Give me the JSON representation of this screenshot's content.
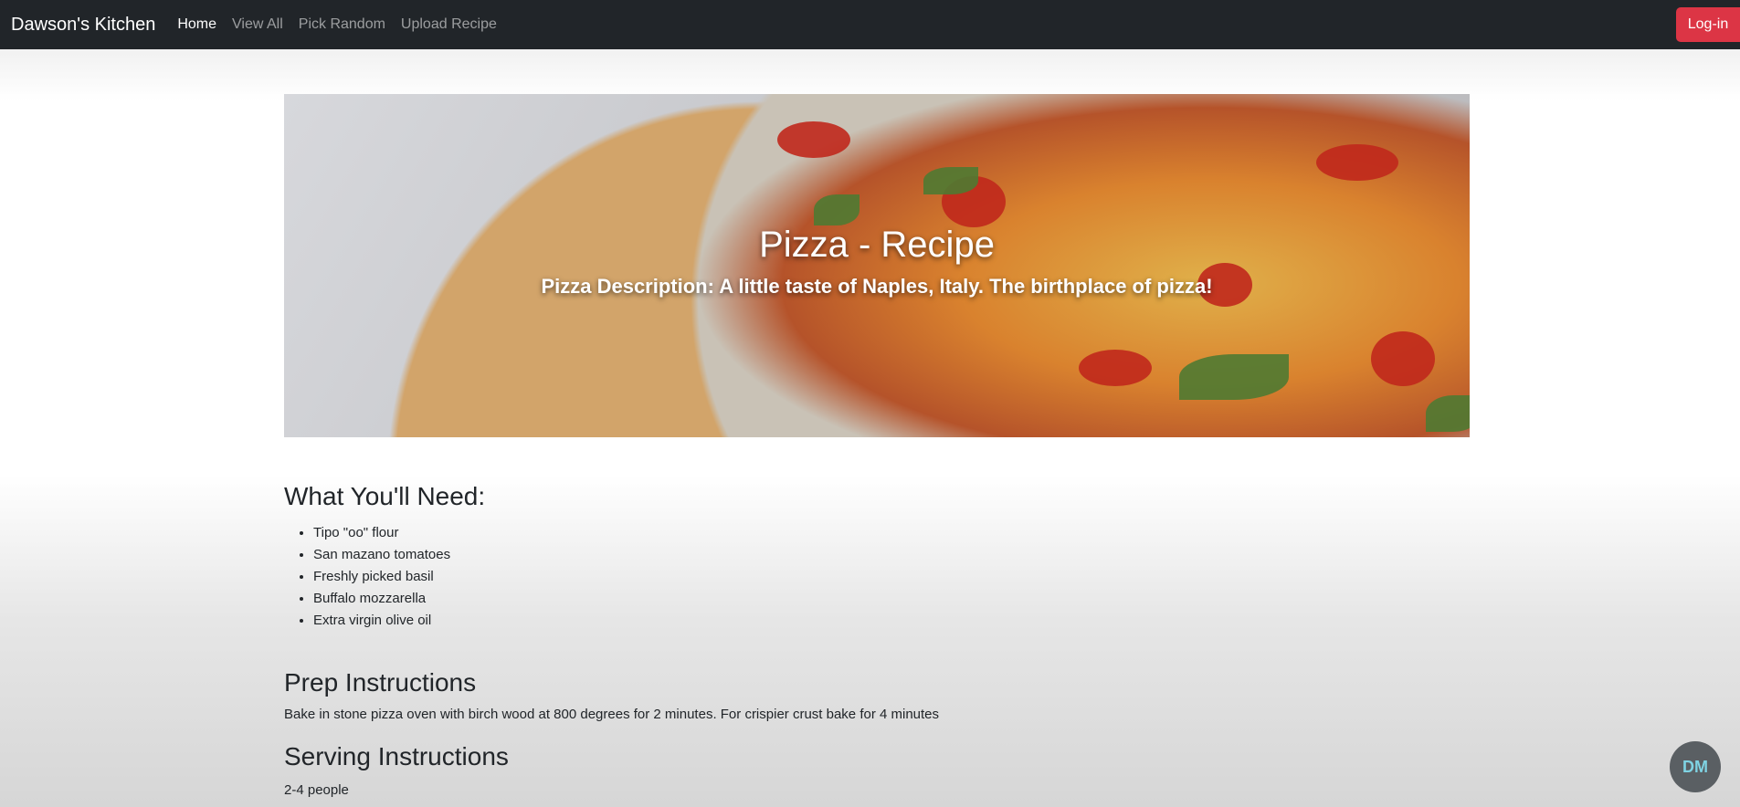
{
  "navbar": {
    "brand": "Dawson's Kitchen",
    "links": [
      {
        "label": "Home",
        "active": true
      },
      {
        "label": "View All",
        "active": false
      },
      {
        "label": "Pick Random",
        "active": false
      },
      {
        "label": "Upload Recipe",
        "active": false
      }
    ],
    "login_label": "Log-in"
  },
  "hero": {
    "title": "Pizza - Recipe",
    "subtitle": "Pizza Description: A little taste of Naples, Italy. The birthplace of pizza!"
  },
  "ingredients": {
    "heading": "What You'll Need:",
    "items": [
      "Tipo \"oo\" flour",
      "San mazano tomatoes",
      "Freshly picked basil",
      "Buffalo mozzarella",
      "Extra virgin olive oil"
    ]
  },
  "prep": {
    "heading": "Prep Instructions",
    "text": "Bake in stone pizza oven with birch wood at 800 degrees for 2 minutes. For crispier crust bake for 4 minutes"
  },
  "serving": {
    "heading": "Serving Instructions",
    "text": "2-4 people"
  },
  "fab": {
    "icon": "dm-logo-icon",
    "label": "DM"
  }
}
